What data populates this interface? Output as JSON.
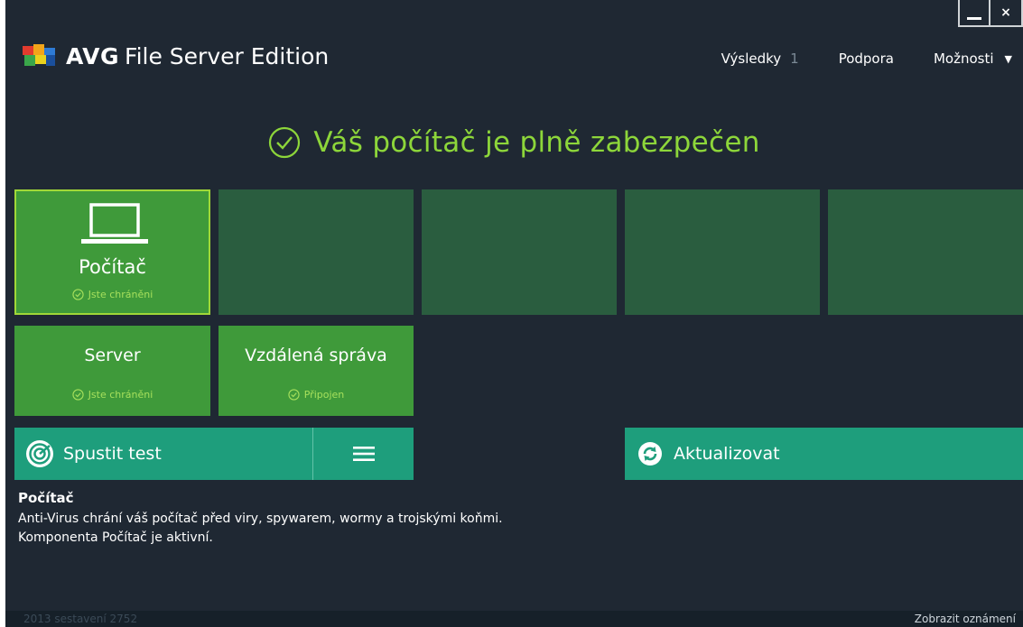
{
  "header": {
    "brand": "AVG",
    "product": "File Server Edition",
    "nav": {
      "results_label": "Výsledky",
      "results_count": "1",
      "support_label": "Podpora",
      "options_label": "Možnosti"
    }
  },
  "window_controls": {
    "minimize": "—",
    "close": "×"
  },
  "status": {
    "text": "Váš počítač je plně zabezpečen",
    "color": "#8dd63a"
  },
  "tiles": [
    {
      "title": "Počítač",
      "status": "Jste chráněni"
    },
    {
      "title": "Server",
      "status": "Jste chráněni"
    },
    {
      "title": "Vzdálená správa",
      "status": "Připojen"
    }
  ],
  "actions": {
    "scan_label": "Spustit test",
    "update_label": "Aktualizovat"
  },
  "description": {
    "title": "Počítač",
    "line1": "Anti-Virus chrání váš počítač před viry, spywarem, wormy a trojskými koňmi.",
    "line2": "Komponenta Počítač je aktivní."
  },
  "footer": {
    "build": "2013  sestavení 2752",
    "notifications": "Zobrazit oznámení"
  },
  "colors": {
    "background": "#1f2833",
    "tile_dark": "#2a5d3f",
    "tile_green": "#3f9a3a",
    "accent_teal": "#1e9e7c",
    "status_green": "#8dd63a"
  }
}
